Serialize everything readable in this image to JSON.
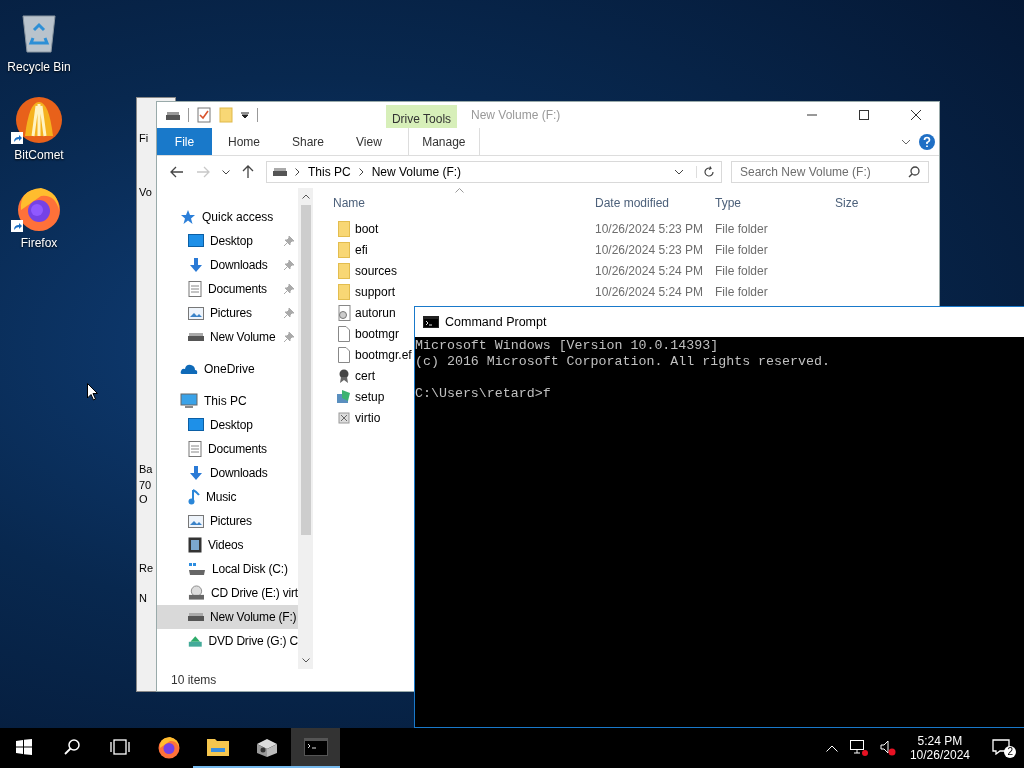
{
  "desktop_icons": [
    {
      "label": "Recycle Bin",
      "kind": "recycle",
      "shortcut": false
    },
    {
      "label": "BitComet",
      "kind": "bitcomet",
      "shortcut": true
    },
    {
      "label": "Firefox",
      "kind": "firefox",
      "shortcut": true
    }
  ],
  "back_window": {
    "fragments": [
      "Fi",
      "Vo",
      "Ba",
      "70",
      "O",
      "Re",
      "N"
    ]
  },
  "explorer": {
    "title": "New Volume (F:)",
    "context_tab": "Drive Tools",
    "ribbon_tabs": [
      {
        "label": "File",
        "kind": "file"
      },
      {
        "label": "Home",
        "kind": "plain"
      },
      {
        "label": "Share",
        "kind": "plain"
      },
      {
        "label": "View",
        "kind": "plain"
      },
      {
        "label": "Manage",
        "kind": "context"
      }
    ],
    "address": {
      "crumbs": [
        "This PC",
        "New Volume (F:)"
      ]
    },
    "search": {
      "placeholder": "Search New Volume (F:)"
    },
    "nav": [
      {
        "label": "Quick access",
        "kind": "quick",
        "selected": false,
        "children": [
          {
            "label": "Desktop",
            "kind": "desktop",
            "pinned": true,
            "selected": false
          },
          {
            "label": "Downloads",
            "kind": "downloads",
            "pinned": true,
            "selected": false
          },
          {
            "label": "Documents",
            "kind": "documents",
            "pinned": true,
            "selected": false
          },
          {
            "label": "Pictures",
            "kind": "pictures",
            "pinned": true,
            "selected": false
          },
          {
            "label": "New Volume",
            "kind": "drive",
            "pinned": true,
            "selected": false
          }
        ]
      },
      {
        "label": "OneDrive",
        "kind": "onedrive",
        "selected": false
      },
      {
        "label": "This PC",
        "kind": "pc",
        "selected": false,
        "children": [
          {
            "label": "Desktop",
            "kind": "desktop",
            "pinned": false,
            "selected": false
          },
          {
            "label": "Documents",
            "kind": "documents",
            "pinned": false,
            "selected": false
          },
          {
            "label": "Downloads",
            "kind": "downloads",
            "pinned": false,
            "selected": false
          },
          {
            "label": "Music",
            "kind": "music",
            "pinned": false,
            "selected": false
          },
          {
            "label": "Pictures",
            "kind": "pictures",
            "pinned": false,
            "selected": false
          },
          {
            "label": "Videos",
            "kind": "videos",
            "pinned": false,
            "selected": false
          },
          {
            "label": "Local Disk (C:)",
            "kind": "localdisk",
            "pinned": false,
            "selected": false
          },
          {
            "label": "CD Drive (E:) virt",
            "kind": "cd",
            "pinned": false,
            "selected": false
          },
          {
            "label": "New Volume (F:)",
            "kind": "drive",
            "pinned": false,
            "selected": true
          },
          {
            "label": "DVD Drive (G:) C",
            "kind": "dvd",
            "pinned": false,
            "selected": false
          }
        ]
      }
    ],
    "columns": [
      "Name",
      "Date modified",
      "Type",
      "Size"
    ],
    "files": [
      {
        "name": "boot",
        "kind": "folder",
        "date": "10/26/2024 5:23 PM",
        "type": "File folder"
      },
      {
        "name": "efi",
        "kind": "folder",
        "date": "10/26/2024 5:23 PM",
        "type": "File folder"
      },
      {
        "name": "sources",
        "kind": "folder",
        "date": "10/26/2024 5:24 PM",
        "type": "File folder"
      },
      {
        "name": "support",
        "kind": "folder",
        "date": "10/26/2024 5:24 PM",
        "type": "File folder"
      },
      {
        "name": "autorun",
        "kind": "settings"
      },
      {
        "name": "bootmgr",
        "kind": "file"
      },
      {
        "name": "bootmgr.ef",
        "kind": "file"
      },
      {
        "name": "cert",
        "kind": "cert"
      },
      {
        "name": "setup",
        "kind": "setup"
      },
      {
        "name": "virtio",
        "kind": "virtio"
      }
    ],
    "status": "10 items"
  },
  "cmd": {
    "title": "Command Prompt",
    "output": [
      "Microsoft Windows [Version 10.0.14393]",
      "(c) 2016 Microsoft Corporation. All rights reserved."
    ],
    "prompt": "C:\\Users\\retard>f"
  },
  "taskbar": {
    "apps": [
      {
        "kind": "firefox",
        "running": false,
        "selected": false
      },
      {
        "kind": "explorer",
        "running": true,
        "selected": false
      },
      {
        "kind": "installer",
        "running": true,
        "selected": false
      },
      {
        "kind": "cmd",
        "running": true,
        "selected": true
      }
    ],
    "time": "5:24 PM",
    "date": "10/26/2024",
    "notifications": "2"
  }
}
